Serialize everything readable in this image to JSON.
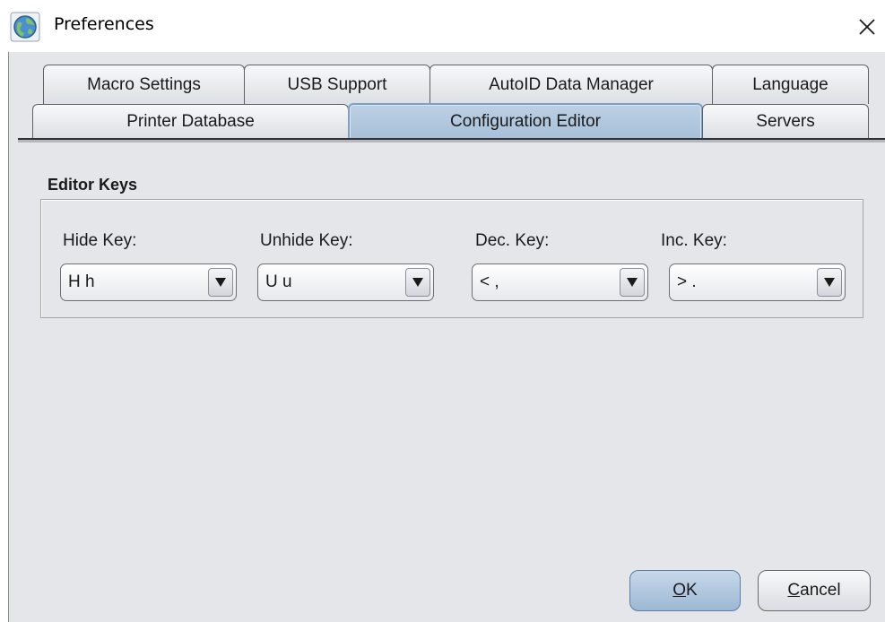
{
  "window": {
    "title": "Preferences",
    "icon": "globe-app-icon",
    "close_icon": "close-icon"
  },
  "tabs": {
    "row_back": [
      {
        "label": "Macro Settings"
      },
      {
        "label": "USB Support"
      },
      {
        "label": "AutoID Data Manager"
      },
      {
        "label": "Language"
      }
    ],
    "row_front": [
      {
        "label": "Printer Database"
      },
      {
        "label": "Configuration Editor",
        "selected": true
      },
      {
        "label": "Servers"
      }
    ]
  },
  "editor_keys": {
    "title": "Editor Keys",
    "fields": [
      {
        "label": "Hide Key:",
        "value": "H h"
      },
      {
        "label": "Unhide Key:",
        "value": "U u"
      },
      {
        "label": "Dec. Key:",
        "value": "< ,"
      },
      {
        "label": "Inc. Key:",
        "value": "> ."
      }
    ]
  },
  "buttons": {
    "ok_mnemonic": "O",
    "ok_rest": "K",
    "cancel_mnemonic": "C",
    "cancel_rest": "ancel"
  },
  "colors": {
    "panel_bg": "#e4e6ea",
    "selected_tab": "#a7c0d8",
    "ok_button": "#9db8d3"
  }
}
